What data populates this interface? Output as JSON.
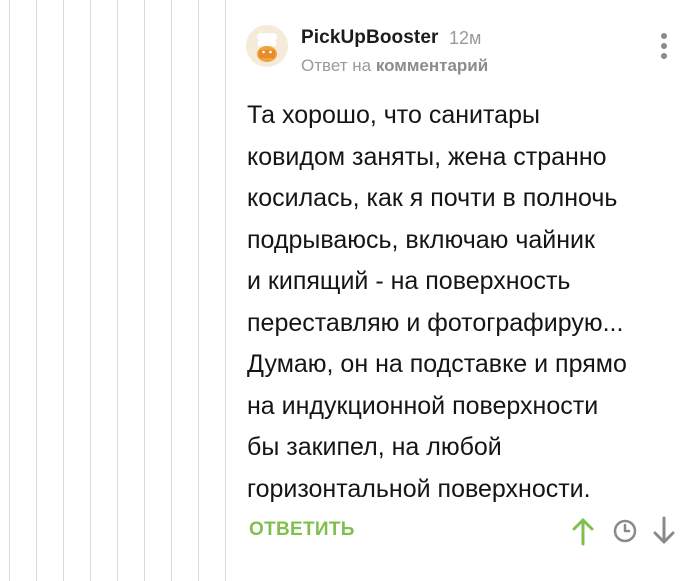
{
  "comment": {
    "author": "PickUpBooster",
    "time": "12м",
    "reply_prefix": "Ответ на",
    "reply_target": "комментарий",
    "text": "Та хорошо, что санитары\nковидом заняты, жена странно\nкосилась, как я почти в полночь\nподрываюсь, включаю чайник\nи кипящий - на поверхность\nпереставляю и фотографирую...\nДумаю, он на подставке и прямо\nна индукционной поверхности\nбы закипел, на любой\nгоризонтальной поверхности.",
    "reply_button": "ОТВЕТИТЬ"
  },
  "colors": {
    "accent": "#7fbf4d",
    "muted": "#9a9a9a",
    "thread_line": "#d9d9d9"
  },
  "icons": {
    "avatar": "avatar-image",
    "more": "more-vertical-icon",
    "upvote": "arrow-up-icon",
    "save": "clock-icon",
    "downvote": "arrow-down-icon"
  }
}
